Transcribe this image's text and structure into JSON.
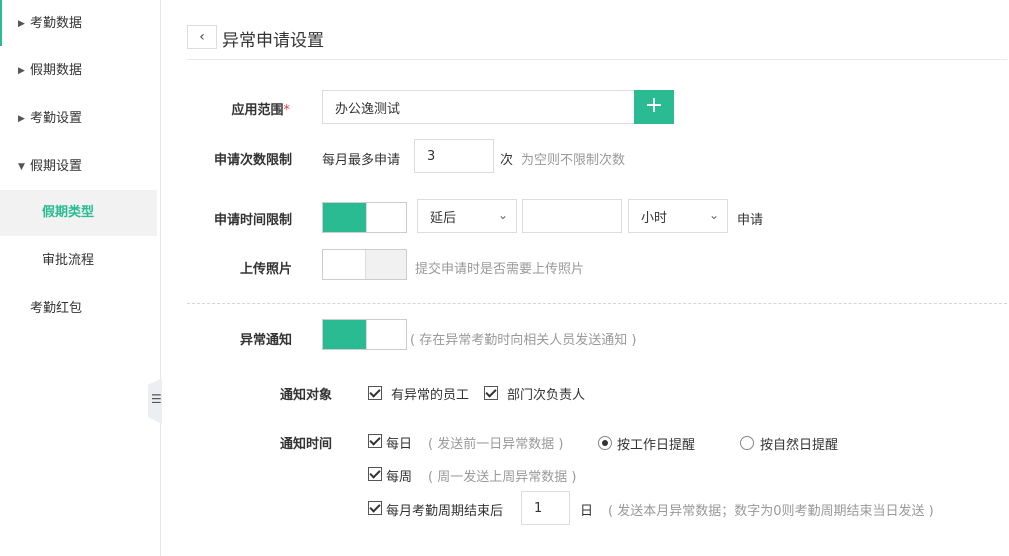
{
  "sidebar": {
    "items": [
      {
        "label": "考勤数据",
        "caret": "▶"
      },
      {
        "label": "假期数据",
        "caret": "▶"
      },
      {
        "label": "考勤设置",
        "caret": "▶"
      },
      {
        "label": "假期设置",
        "caret": "▼"
      }
    ],
    "subitems": [
      {
        "label": "假期类型"
      },
      {
        "label": "审批流程"
      }
    ],
    "extra": {
      "label": "考勤红包"
    },
    "collapse_icon": "☰"
  },
  "header": {
    "back_icon": "‹",
    "title": "异常申请设置"
  },
  "form": {
    "scope": {
      "label": "应用范围",
      "required": "*",
      "value": "办公逸测试",
      "add_icon": "+"
    },
    "count_limit": {
      "label": "申请次数限制",
      "prefix": "每月最多申请",
      "value": "3",
      "unit": "次",
      "hint": "为空则不限制次数"
    },
    "time_limit": {
      "label": "申请时间限制",
      "toggle": "on",
      "direction": "延后",
      "amount": "",
      "unit": "小时",
      "suffix": "申请"
    },
    "photo": {
      "label": "上传照片",
      "toggle": "off",
      "hint": "提交申请时是否需要上传照片"
    },
    "notice": {
      "label": "异常通知",
      "toggle": "on",
      "hint": "( 存在异常考勤时向相关人员发送通知 )"
    },
    "notice_target": {
      "label": "通知对象",
      "options": [
        "有异常的员工",
        "部门次负责人"
      ]
    },
    "notice_time": {
      "label": "通知时间",
      "daily": {
        "label": "每日",
        "hint": "( 发送前一日异常数据 )"
      },
      "radios": [
        {
          "label": "按工作日提醒",
          "checked": true
        },
        {
          "label": "按自然日提醒",
          "checked": false
        }
      ],
      "weekly": {
        "label": "每周",
        "hint": "( 周一发送上周异常数据 )"
      },
      "monthly": {
        "label": "每月考勤周期结束后",
        "value": "1",
        "unit": "日",
        "hint": "( 发送本月异常数据；数字为0则考勤周期结束当日发送 )"
      }
    }
  },
  "colors": {
    "accent": "#2bbb93",
    "required": "#e4393c"
  }
}
